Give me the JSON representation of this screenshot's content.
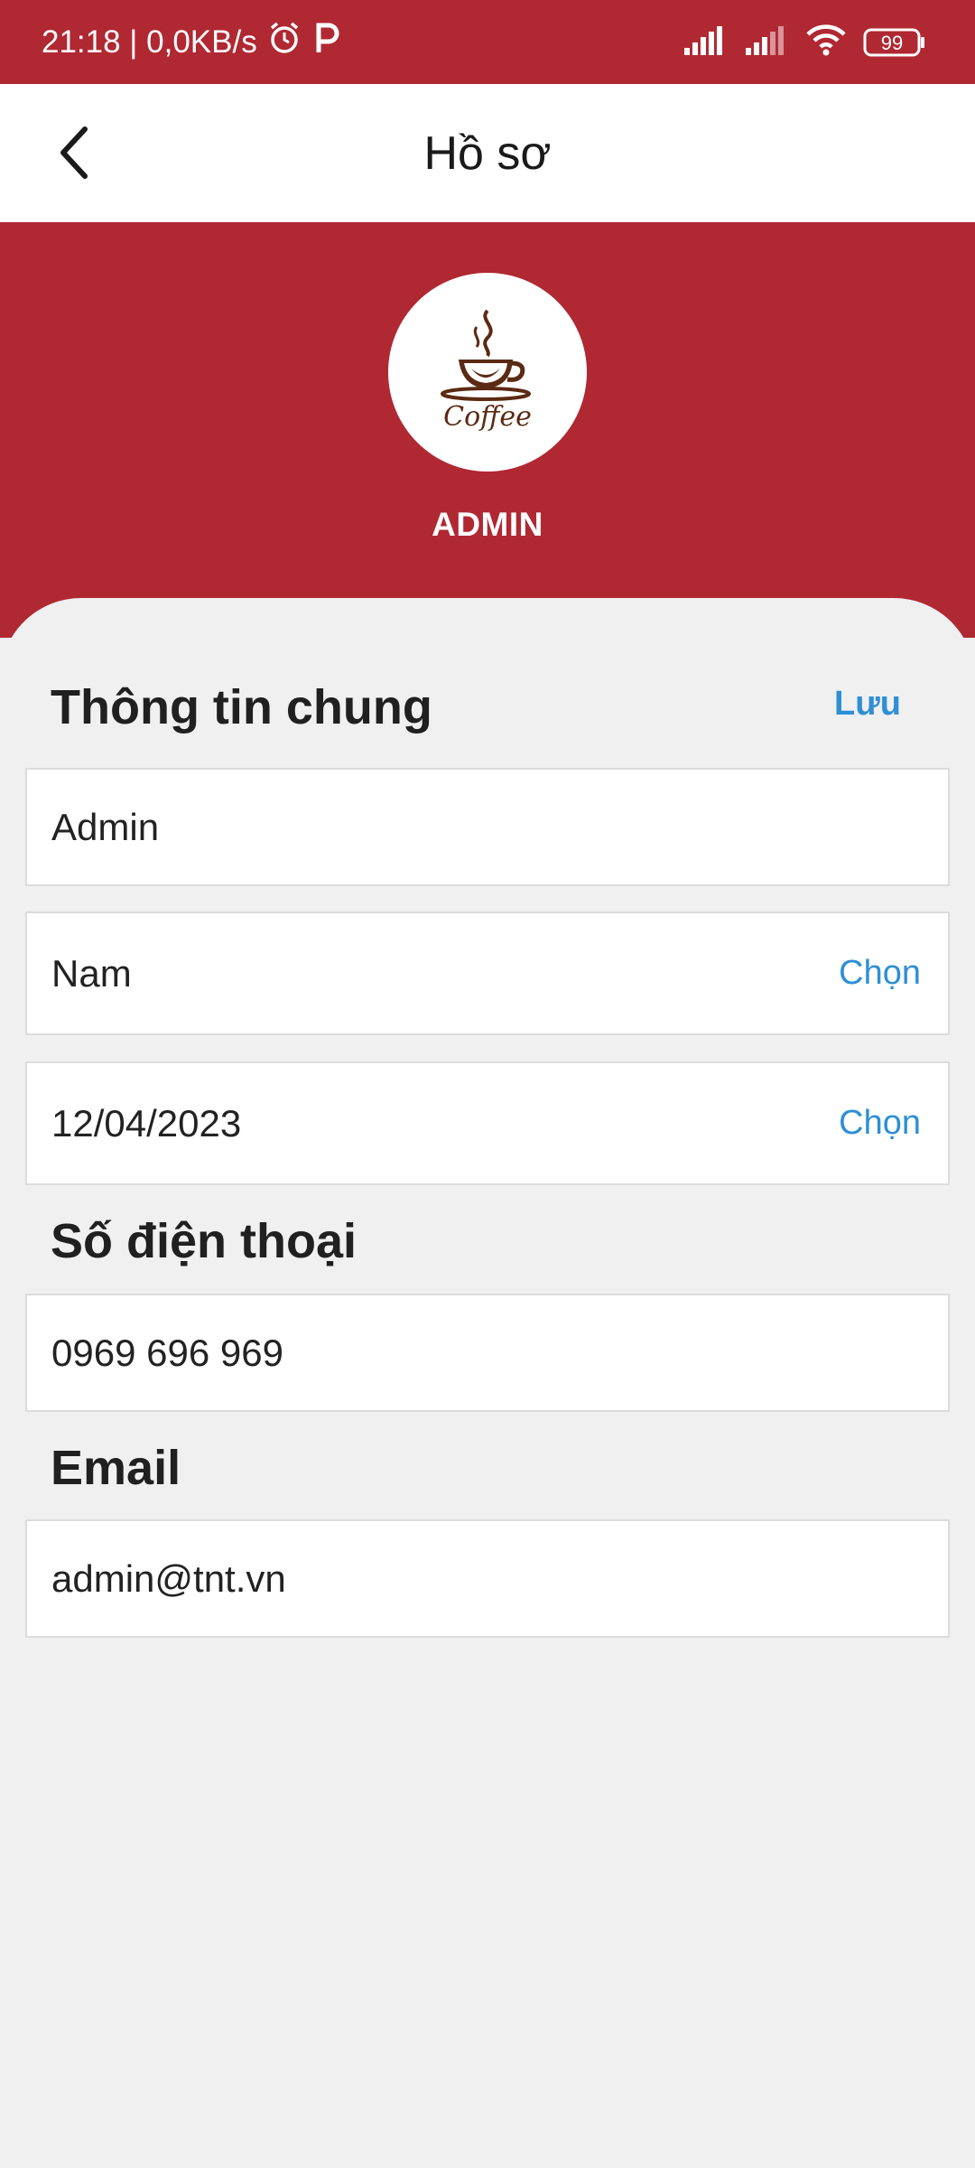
{
  "status_bar": {
    "time_and_speed": "21:18 | 0,0KB/s",
    "battery": "99"
  },
  "app_bar": {
    "title": "Hồ sơ"
  },
  "profile": {
    "logo_text": "Coffee",
    "name": "ADMIN"
  },
  "general_info": {
    "title": "Thông tin chung",
    "save_label": "Lưu",
    "name_value": "Admin",
    "gender_value": "Nam",
    "gender_action": "Chọn",
    "dob_value": "12/04/2023",
    "dob_action": "Chọn"
  },
  "phone": {
    "title": "Số điện thoại",
    "value": "0969 696 969"
  },
  "email": {
    "title": "Email",
    "value": "admin@tnt.vn"
  },
  "colors": {
    "brand_red": "#b02832",
    "link_blue": "#2e8fd6"
  }
}
